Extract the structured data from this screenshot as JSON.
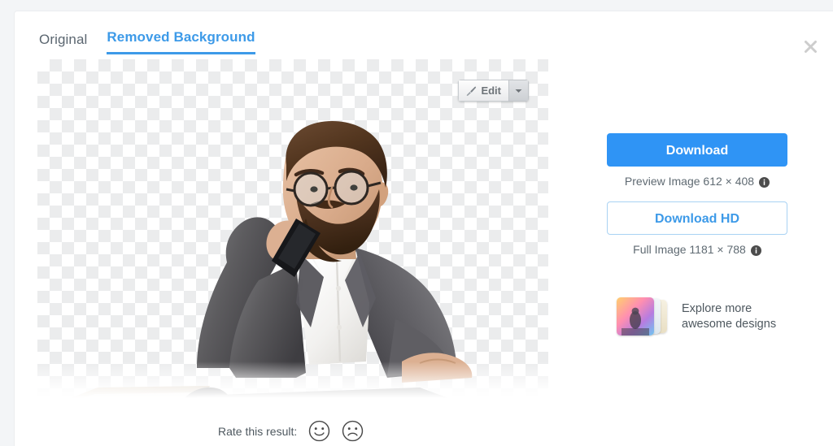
{
  "tabs": [
    {
      "label": "Original",
      "active": false
    },
    {
      "label": "Removed Background",
      "active": true
    }
  ],
  "close": {
    "icon": "close-icon",
    "label": "×"
  },
  "preview": {
    "edit_button": {
      "label": "Edit",
      "icon": "brush-icon",
      "caret_icon": "chevron-down-icon"
    },
    "alt": "Bearded man with glasses talking on a mobile phone at a desk with a keyboard, background removed"
  },
  "sidebar": {
    "download": {
      "label": "Download"
    },
    "preview_caption": {
      "text": "Preview Image 612 × 408",
      "info_icon": "info-icon"
    },
    "download_hd": {
      "label": "Download HD"
    },
    "full_caption": {
      "text": "Full Image 1181 × 788",
      "info_icon": "info-icon"
    },
    "explore": {
      "line1": "Explore more",
      "line2": "awesome designs"
    }
  },
  "rating": {
    "label": "Rate this result:",
    "positive_icon": "smiley-face-icon",
    "negative_icon": "frowny-face-icon"
  },
  "colors": {
    "accent_blue": "#3d9ae8",
    "button_blue": "#2f94f5",
    "page_bg": "#f3f5f7",
    "card_bg": "#ffffff",
    "text_gray": "#5b6670"
  }
}
